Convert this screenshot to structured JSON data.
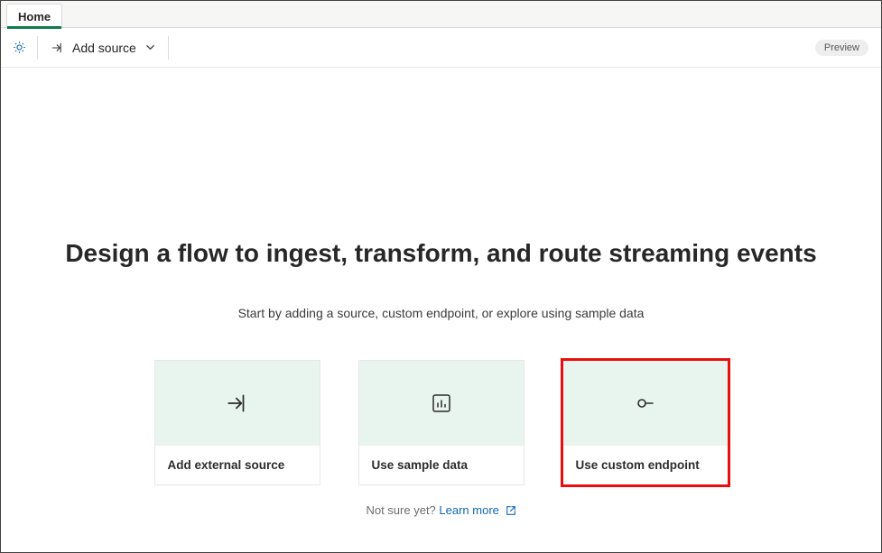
{
  "tabs": {
    "home": "Home"
  },
  "toolbar": {
    "add_source": "Add source",
    "preview_badge": "Preview"
  },
  "main": {
    "headline": "Design a flow to ingest, transform, and route streaming events",
    "subline": "Start by adding a source, custom endpoint, or explore using sample data"
  },
  "cards": {
    "external": "Add external source",
    "sample": "Use sample data",
    "custom": "Use custom endpoint"
  },
  "learn": {
    "prefix": "Not sure yet? ",
    "link": "Learn more"
  }
}
